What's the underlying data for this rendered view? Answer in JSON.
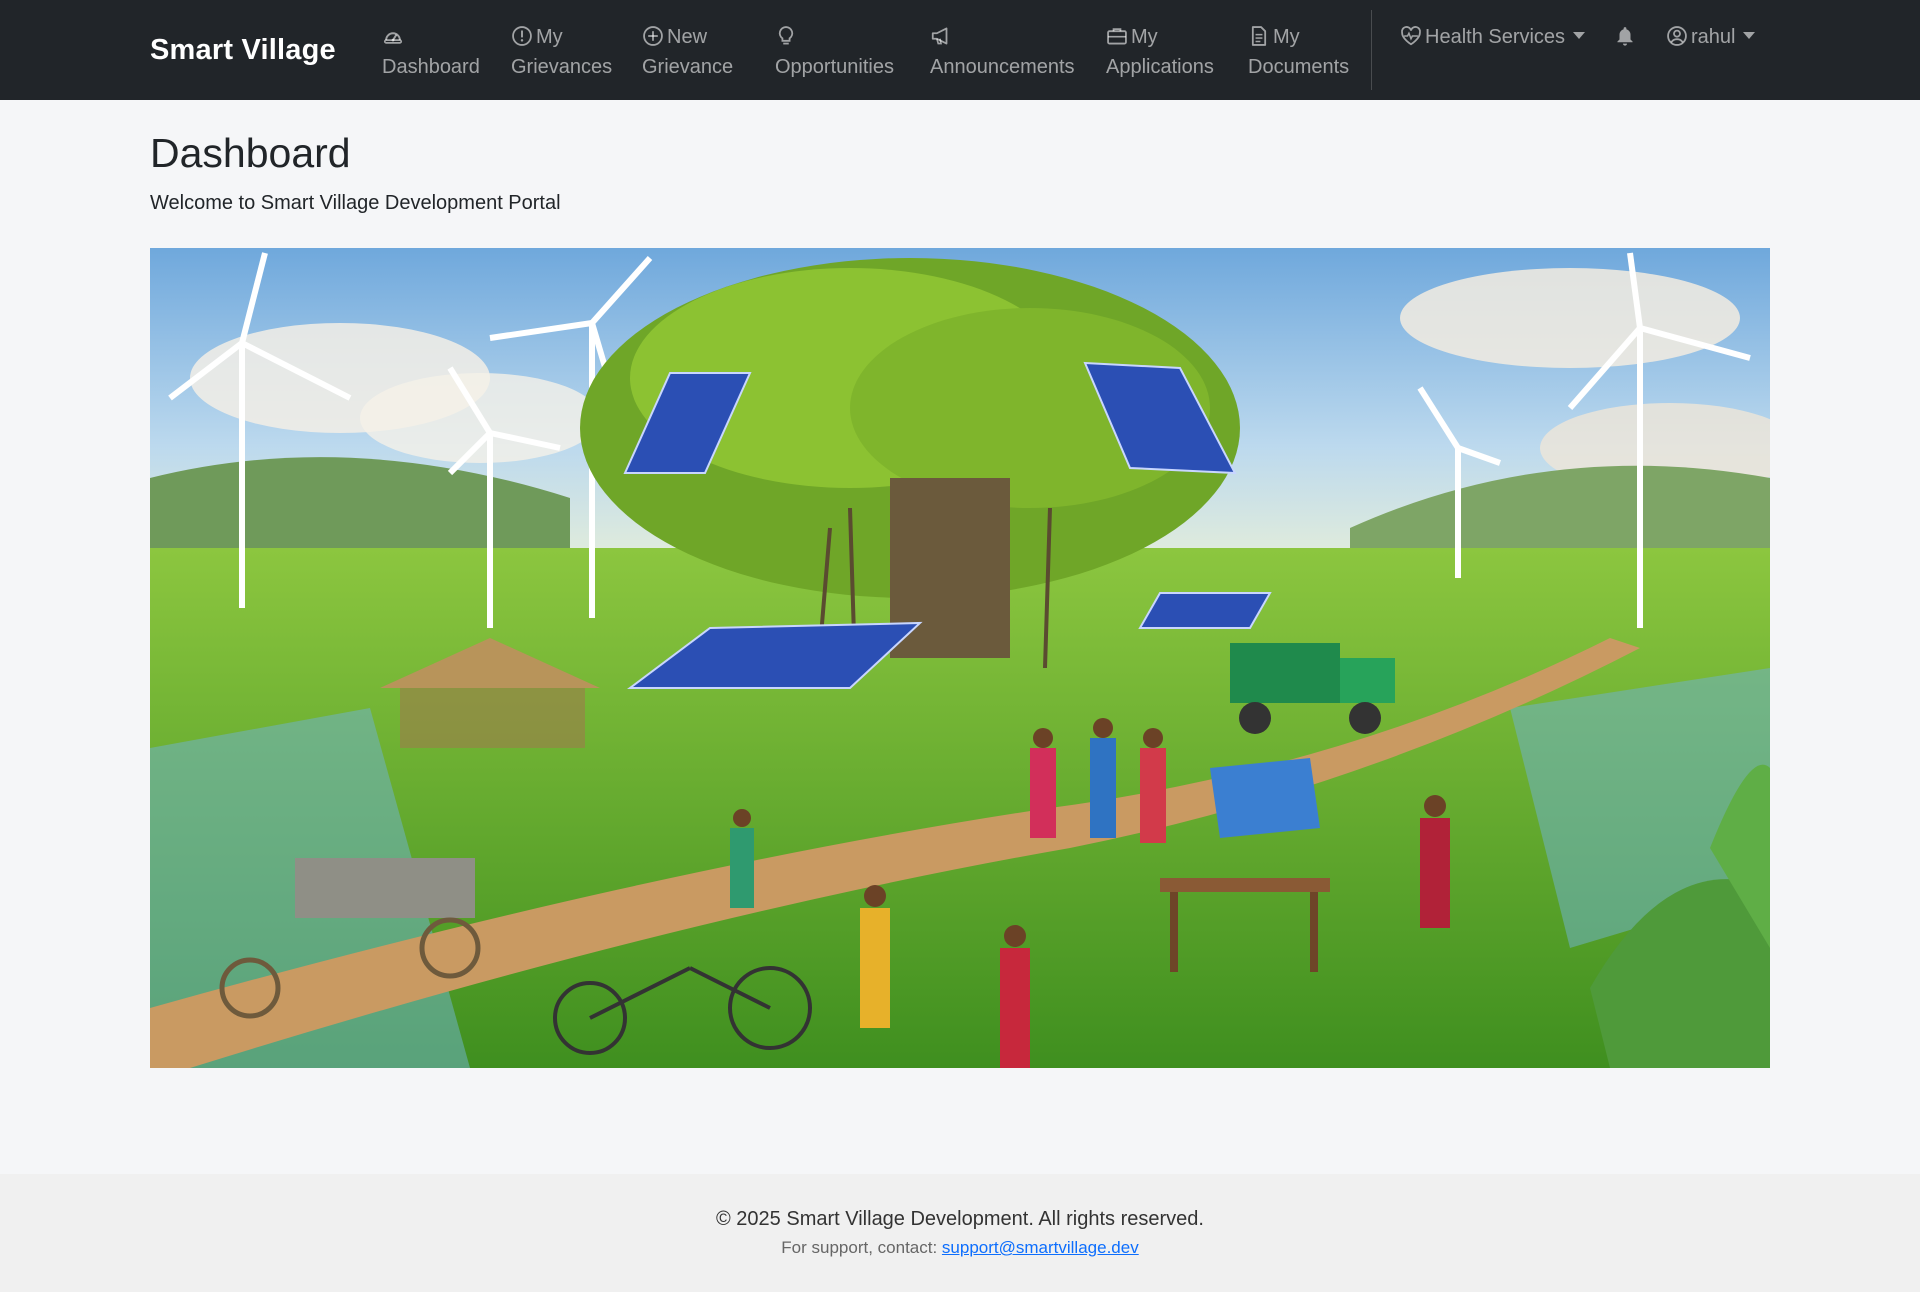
{
  "navbar": {
    "brand": "Smart Village",
    "items": [
      {
        "line1": "",
        "line2": "Dashboard",
        "icon": "speedometer-icon"
      },
      {
        "line1": "My",
        "line2": "Grievances",
        "icon": "exclamation-circle-icon"
      },
      {
        "line1": "New",
        "line2": "Grievance",
        "icon": "plus-circle-icon"
      },
      {
        "line1": "",
        "line2": "Opportunities",
        "icon": "lightbulb-icon"
      },
      {
        "line1": "",
        "line2": "Announcements",
        "icon": "megaphone-icon"
      },
      {
        "line1": "My",
        "line2": "Applications",
        "icon": "briefcase-icon"
      },
      {
        "line1": "My",
        "line2": "Documents",
        "icon": "document-icon"
      }
    ],
    "health_services": "Health Services",
    "notifications_icon": "bell-icon",
    "user": "rahul",
    "user_icon": "person-circle-icon"
  },
  "main": {
    "title": "Dashboard",
    "subtitle": "Welcome to Smart Village Development Portal",
    "hero_alt": "smart village illustration"
  },
  "footer": {
    "copyright": "© 2025 Smart Village Development. All rights reserved.",
    "support_prefix": "For support, contact: ",
    "support_email": "support@smartvillage.dev"
  },
  "colors": {
    "navbar_bg": "#212529",
    "page_bg": "#f5f6f8",
    "link": "#0d6efd"
  }
}
